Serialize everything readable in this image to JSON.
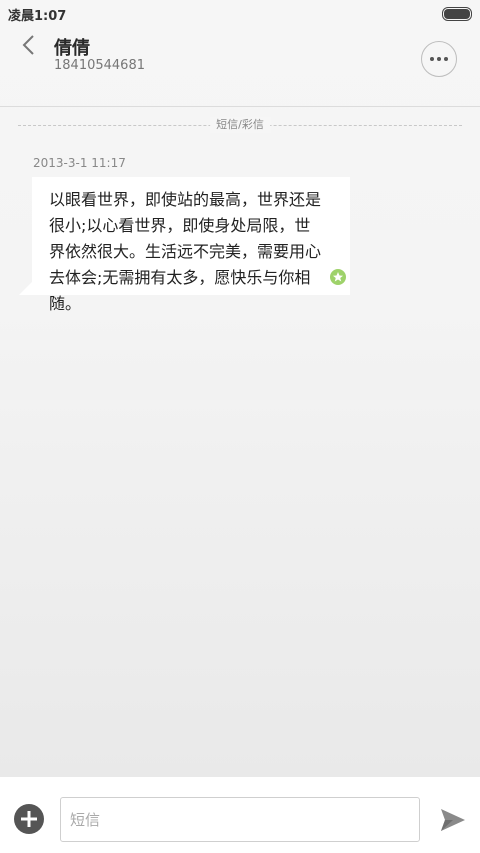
{
  "status_bar": {
    "time": "凌晨1:07"
  },
  "header": {
    "contact_name": "倩倩",
    "contact_number": "18410544681"
  },
  "thread": {
    "divider_label": "短信/彩信",
    "messages": [
      {
        "timestamp": "2013-3-1 11:17",
        "text": "以眼看世界，即使站的最高，世界还是很小;以心看世界，即使身处局限，世界依然很大。生活远不完美，需要用心去体会;无需拥有太多，愿快乐与你相随。"
      }
    ]
  },
  "composer": {
    "placeholder": "短信"
  },
  "icons": {
    "back": "chevron-left-icon",
    "more": "more-dots-icon",
    "status": "sent-star-icon",
    "add": "plus-icon",
    "send": "send-icon",
    "battery": "battery-icon"
  },
  "colors": {
    "sent_indicator": "#9ed26a",
    "add_button": "#555555",
    "send_icon": "#8a8a8a"
  }
}
